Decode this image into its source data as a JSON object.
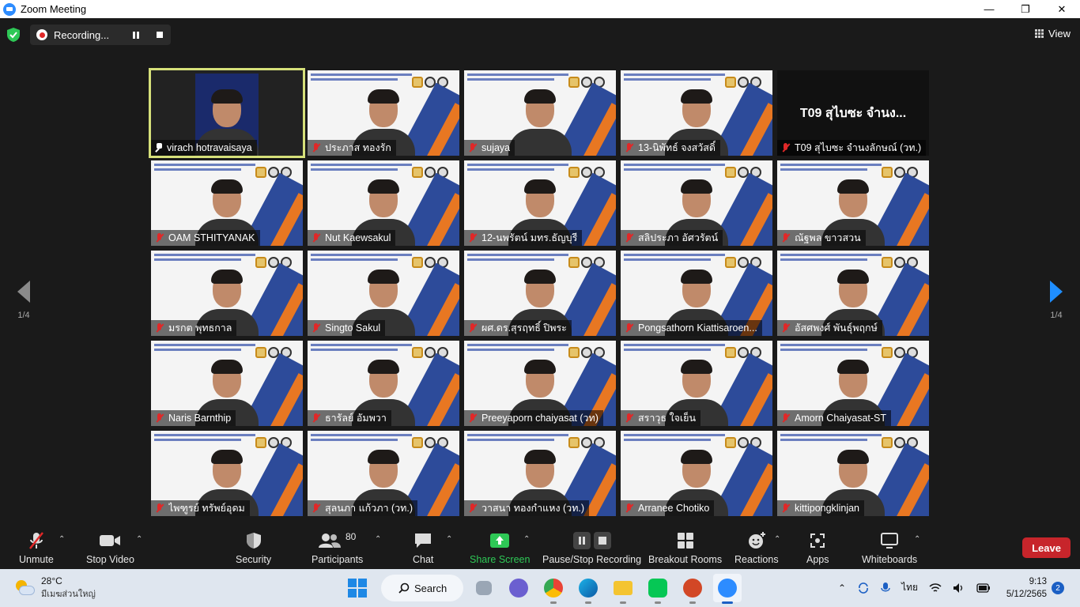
{
  "window": {
    "title": "Zoom Meeting",
    "minimize": "—",
    "restore": "❐",
    "close": "✕"
  },
  "recording": {
    "label": "Recording..."
  },
  "view": {
    "label": "View"
  },
  "pager": {
    "left": "1/4",
    "right": "1/4"
  },
  "tiles": [
    {
      "name": "virach hotravaisaya",
      "active": true,
      "pinned": true
    },
    {
      "name": "ประภาส ทองรัก"
    },
    {
      "name": "sujaya"
    },
    {
      "name": "13-นิพัทธ์ จงสวัสดิ์"
    },
    {
      "name": "T09 สุไบซะ จำนงลักษณ์ (วท.)",
      "bigname": "T09 สุไบซะ จำนง...",
      "no_video": true
    },
    {
      "name": "OAM STHITYANAK"
    },
    {
      "name": "Nut Kaewsakul"
    },
    {
      "name": "12-นพรัตน์ มทร.ธัญบุรี"
    },
    {
      "name": "สลิประภา อัศวรัตน์"
    },
    {
      "name": "ณัฐพล ขาวสวน"
    },
    {
      "name": "มรกต พุทธกาล"
    },
    {
      "name": "Singto Sakul"
    },
    {
      "name": "ผศ.ดร.สุรฤทธิ์ ปิพระ"
    },
    {
      "name": "Pongsathorn Kiattisaroen..."
    },
    {
      "name": "อัสศพงศ์ พันธุ์พฤกษ์"
    },
    {
      "name": "Naris Barnthip"
    },
    {
      "name": "ธารัลย์ อัมพวา"
    },
    {
      "name": "Preeyaporn chaiyasat (วท)"
    },
    {
      "name": "สราวุธ ใจเย็น"
    },
    {
      "name": "Amorn Chaiyasat-ST"
    },
    {
      "name": "ไพฑูรย์ ทรัพย์อุดม"
    },
    {
      "name": "สุลนภา แก้วภา (วท.)"
    },
    {
      "name": "วาสนา ทองกำแหง (วท.)"
    },
    {
      "name": "Arranee Chotiko"
    },
    {
      "name": "kittipongklinjan"
    }
  ],
  "toolbar": {
    "unmute": "Unmute",
    "stop_video": "Stop Video",
    "security": "Security",
    "participants": "Participants",
    "participants_count": "80",
    "chat": "Chat",
    "share_screen": "Share Screen",
    "pause_stop_recording": "Pause/Stop Recording",
    "breakout_rooms": "Breakout Rooms",
    "reactions": "Reactions",
    "apps": "Apps",
    "whiteboards": "Whiteboards",
    "leave": "Leave",
    "caret": "⌃"
  },
  "taskbar": {
    "temperature": "28°C",
    "weather_desc": "มีเมฆส่วนใหญ่",
    "search_label": "Search",
    "language": "ไทย",
    "time": "9:13",
    "date": "5/12/2565",
    "notifications": "2",
    "up_arrow": "⌃"
  },
  "colors": {
    "accent_blue": "#2d8cff",
    "share_green": "#2ec856",
    "leave_red": "#c7252b",
    "active_border": "#d6e07a"
  }
}
